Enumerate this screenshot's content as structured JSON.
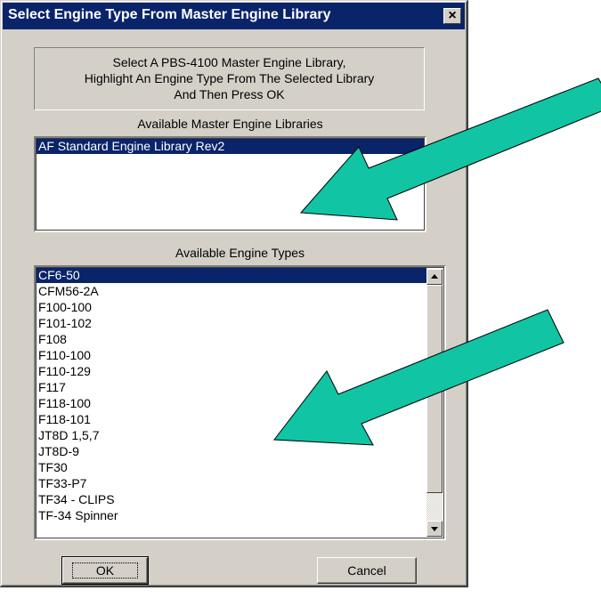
{
  "dialog": {
    "title": "Select Engine Type From Master Engine Library",
    "close_label": "×",
    "instructions": [
      "Select A PBS-4100 Master Engine Library,",
      "Highlight An Engine Type From The Selected  Library",
      "And Then Press OK"
    ]
  },
  "libraries": {
    "label": "Available Master Engine Libraries",
    "items": [
      "AF Standard Engine Library Rev2"
    ],
    "selected_index": 0
  },
  "engines": {
    "label": "Available Engine Types",
    "items": [
      "CF6-50",
      "CFM56-2A",
      "F100-100",
      "F101-102",
      "F108",
      "F110-100",
      "F110-129",
      "F117",
      "F118-100",
      "F118-101",
      "JT8D 1,5,7",
      "JT8D-9",
      "TF30",
      "TF33-P7",
      "TF34 - CLIPS",
      "TF-34 Spinner"
    ],
    "selected_index": 0
  },
  "buttons": {
    "ok": "OK",
    "cancel": "Cancel"
  },
  "colors": {
    "titlebar": "#0a246a",
    "selection": "#0a246a",
    "dialog_face": "#d4d0c8",
    "arrow_fill": "#11c4a3"
  },
  "icons": {
    "close": "close-icon",
    "scroll_up": "scroll-up-arrow-icon",
    "scroll_down": "scroll-down-arrow-icon",
    "annotation": "pointer-arrow-icon"
  }
}
